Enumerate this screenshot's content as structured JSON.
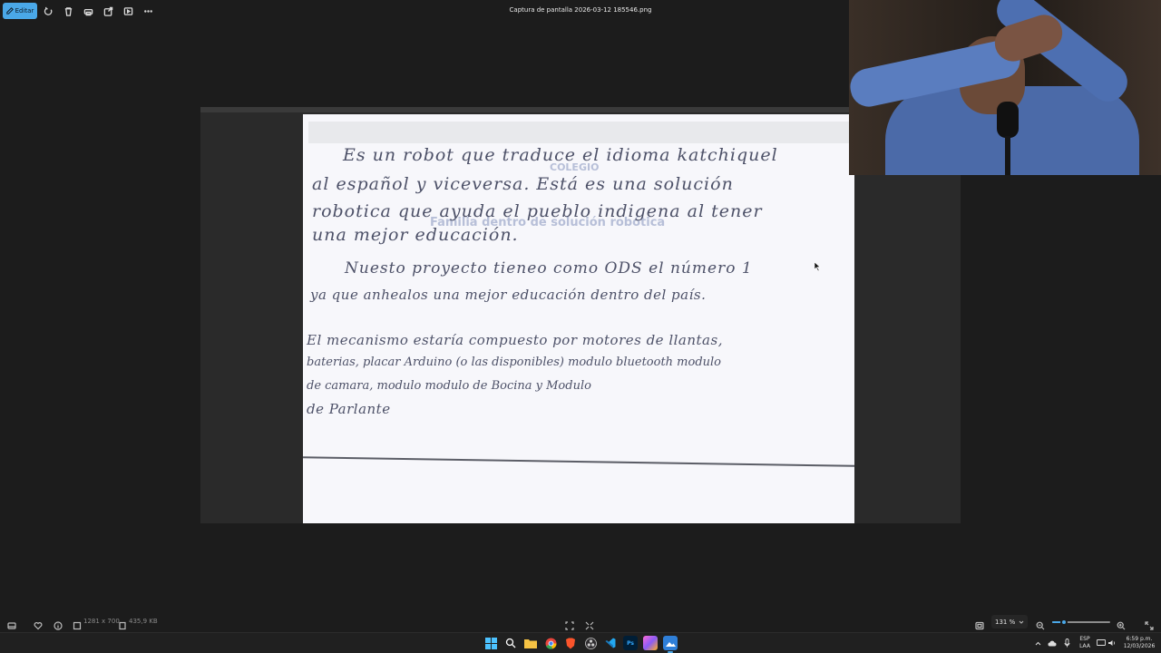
{
  "toolbar": {
    "edit_label": "Editar",
    "icons": [
      "edit-icon",
      "rotate-icon",
      "delete-icon",
      "print-icon",
      "share-icon",
      "slideshow-icon",
      "more-icon"
    ]
  },
  "window": {
    "title": "Captura de pantalla 2026-03-12 185546.png"
  },
  "image_text": {
    "p1_l1": "Es un robot que traduce el idioma katchiquel",
    "p1_l2": "al español y viceversa. Está es una solución",
    "p1_l3": "robotica que ayuda el pueblo indigena al tener",
    "p1_l4": "una mejor educación.",
    "p2_l1": "Nuesto proyecto tieneo como ODS el número 1",
    "p2_l2": "ya que anhealos una mejor educación dentro del país.",
    "p3_l1": "El mecanismo estaría compuesto por motores de llantas,",
    "p3_l2": "baterias, placar Arduino (o las disponibles) modulo bluetooth modulo",
    "p3_l3": "de camara, modulo          modulo de Bocina y Modulo",
    "p3_l4": "de Parlante",
    "watermark_1": "COLEGIO",
    "watermark_2": "Familia dentro de solución robótica"
  },
  "status": {
    "dimensions": "1281 x 700",
    "file_size": "435,9 KB",
    "zoom": "131 %",
    "zoom_level_percent": 20
  },
  "taskbar": {
    "apps": [
      "windows-start-icon",
      "search-icon",
      "file-explorer-icon",
      "brave-icon",
      "chrome-icon",
      "obs-icon",
      "vscode-icon",
      "photoshop-icon",
      "app-icon",
      "photos-icon"
    ],
    "photoshop_label": "Ps",
    "lang_1": "ESP",
    "lang_2": "LAA",
    "time": "6:59 p.m.",
    "date": "12/03/2026"
  },
  "colors": {
    "accent": "#4aa8e8",
    "background": "#1c1c1c",
    "ink": "#4d5168"
  }
}
